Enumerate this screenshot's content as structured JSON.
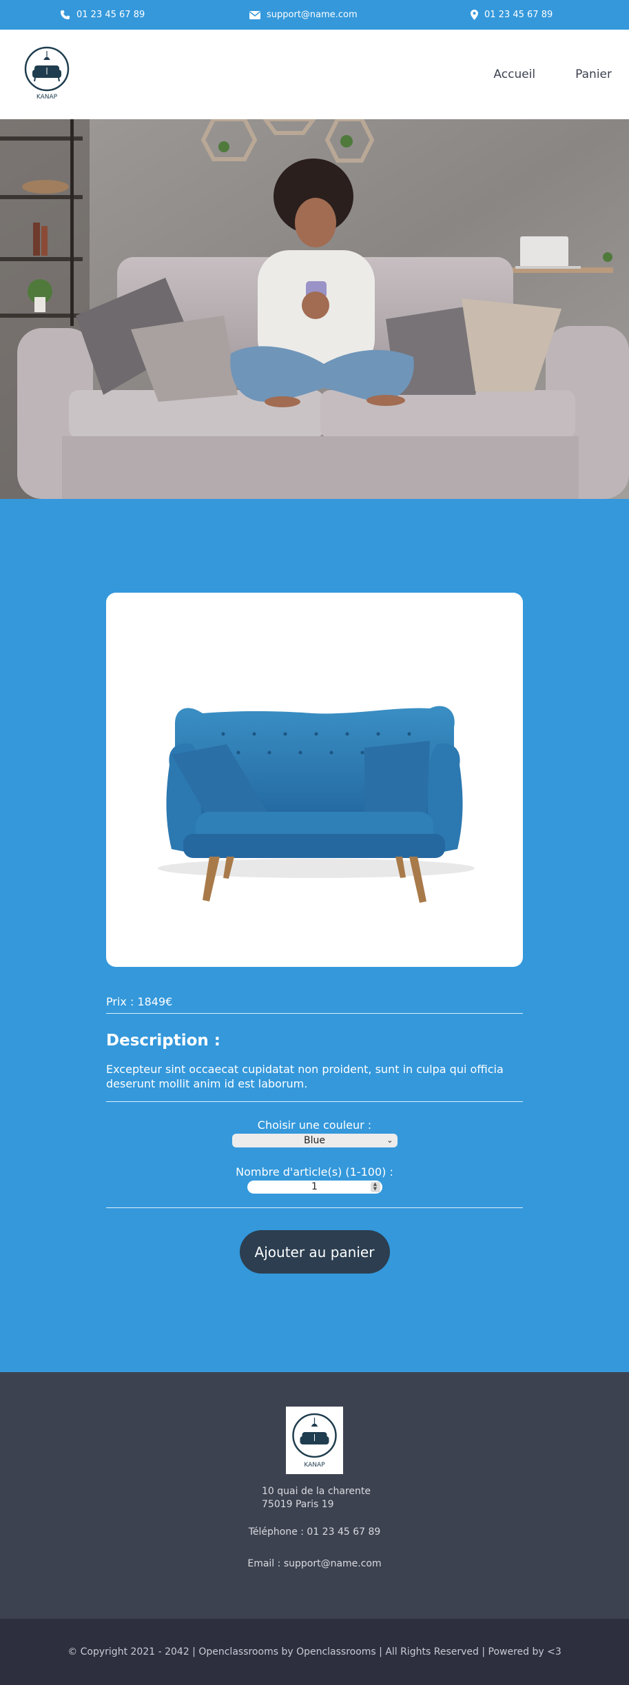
{
  "topbar": {
    "phone": "01 23 45 67 89",
    "email": "support@name.com",
    "location": "01 23 45 67 89"
  },
  "logo": {
    "text": "KANAP"
  },
  "nav": {
    "home": "Accueil",
    "cart": "Panier"
  },
  "product": {
    "price_label": "Prix : 1849€",
    "description_title": "Description :",
    "description_text": "Excepteur sint occaecat cupidatat non proident, sunt in culpa qui officia deserunt mollit anim id est laborum.",
    "color_label": "Choisir une couleur :",
    "color_value": "Blue",
    "quantity_label": "Nombre d'article(s) (1-100) :",
    "quantity_value": "1",
    "add_button": "Ajouter au panier"
  },
  "footer": {
    "address_line1": "10 quai de la charente",
    "address_line2": "75019 Paris 19",
    "phone": "Téléphone : 01 23 45 67 89",
    "email": "Email : support@name.com",
    "copyright": "© Copyright 2021 - 2042 | Openclassrooms by Openclassrooms | All Rights Reserved | Powered by <3"
  },
  "colors": {
    "accent": "#3498db",
    "dark": "#3d4250",
    "darker": "#2d2f3f",
    "button": "#2c3e50",
    "sofa_blue": "#2f7fb5"
  }
}
